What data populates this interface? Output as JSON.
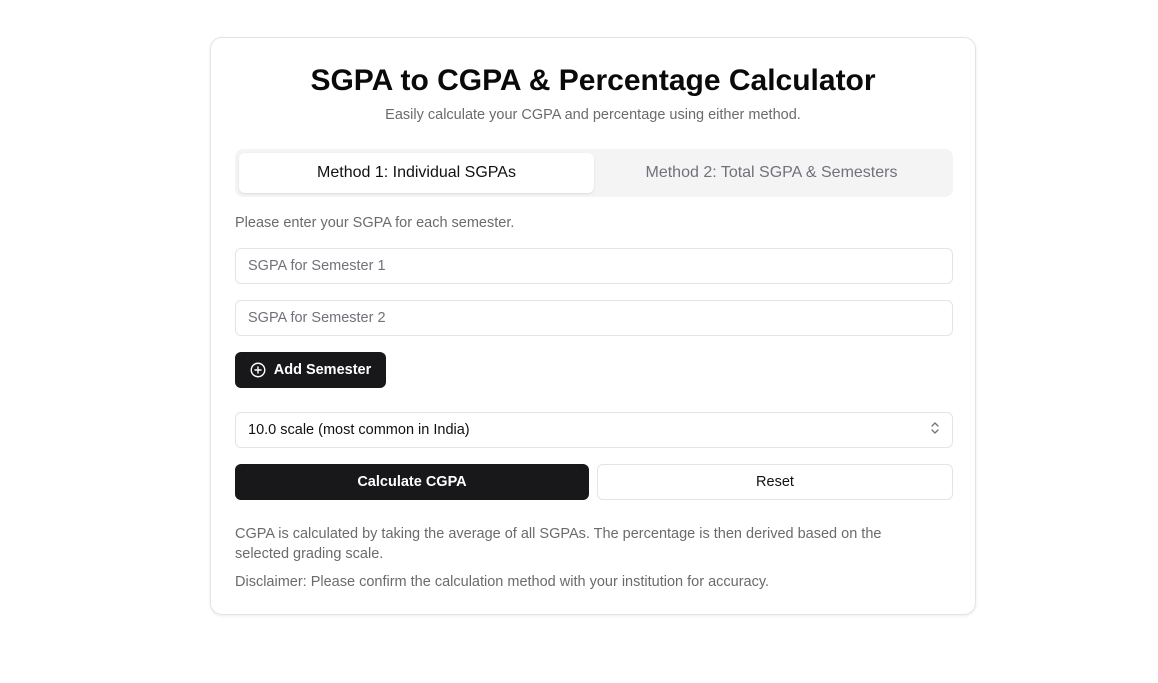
{
  "header": {
    "title": "SGPA to CGPA & Percentage Calculator",
    "subtitle": "Easily calculate your CGPA and percentage using either method."
  },
  "tabs": [
    {
      "label": "Method 1: Individual SGPAs",
      "active": true
    },
    {
      "label": "Method 2: Total SGPA & Semesters",
      "active": false
    }
  ],
  "method1": {
    "instruction": "Please enter your SGPA for each semester.",
    "inputs": [
      {
        "value": "",
        "placeholder": "SGPA for Semester 1"
      },
      {
        "value": "",
        "placeholder": "SGPA for Semester 2"
      }
    ],
    "add_label": "Add Semester",
    "add_icon": "plus-circle-icon"
  },
  "scale_select": {
    "selected": "10.0 scale (most common in India)",
    "icon": "chevron-up-down-icon"
  },
  "actions": {
    "calculate_label": "Calculate CGPA",
    "reset_label": "Reset"
  },
  "footer": {
    "info": "CGPA is calculated by taking the average of all SGPAs. The percentage is then derived based on the selected grading scale.",
    "disclaimer": "Disclaimer: Please confirm the calculation method with your institution for accuracy."
  },
  "colors": {
    "primary": "#18181b",
    "muted_text": "#6b6b6b",
    "border": "#e4e4e7",
    "tab_background": "#f4f4f5"
  }
}
